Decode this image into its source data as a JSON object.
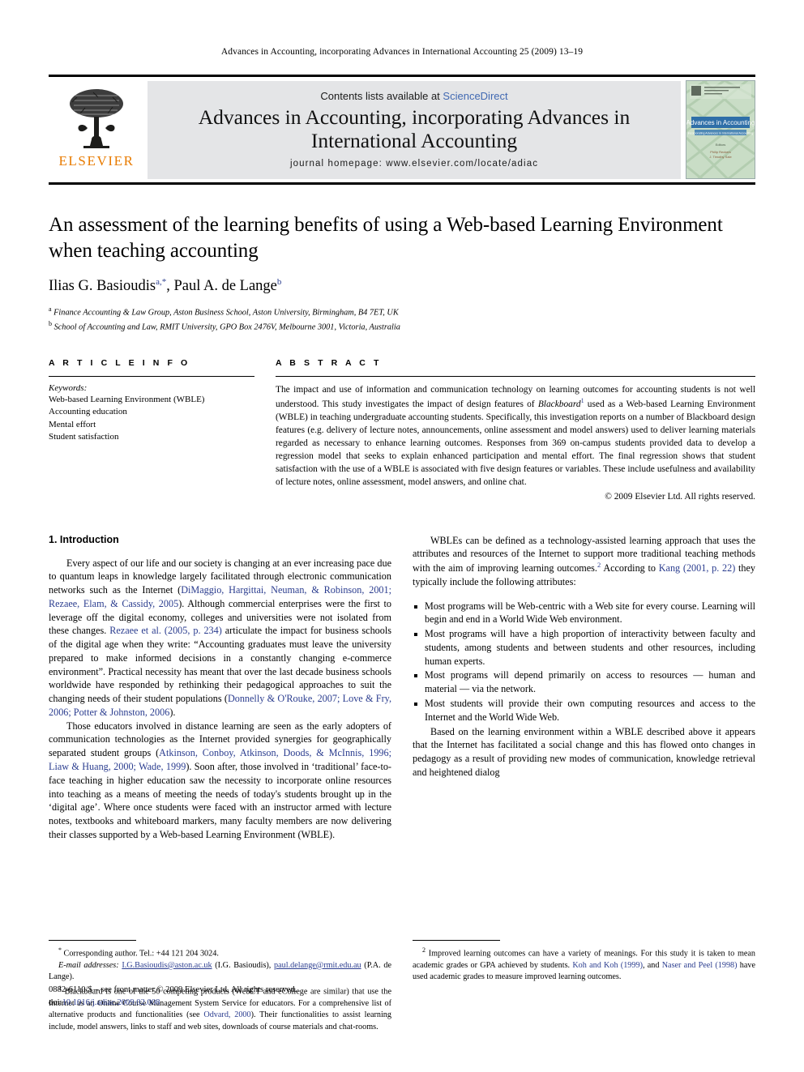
{
  "running_head": "Advances in Accounting, incorporating Advances in International Accounting 25 (2009) 13–19",
  "masthead": {
    "publisher_name": "ELSEVIER",
    "contents_prefix": "Contents lists available at",
    "contents_link": "ScienceDirect",
    "journal_title": "Advances in Accounting, incorporating Advances in International Accounting",
    "homepage": "journal homepage: www.elsevier.com/locate/adiac",
    "cover": {
      "title": "Advances in Accounting",
      "subtitle": "incorporating Advances in International Accounting",
      "editors_label": "Editors",
      "editor_1": "Philip Reckers",
      "editor_2": "J. Timothy Sale"
    }
  },
  "article": {
    "title": "An assessment of the learning benefits of using a Web-based Learning Environment when teaching accounting",
    "authors": "Ilias G. Basioudis a,*, Paul A. de Lange b",
    "author_1_name": "Ilias G. Basioudis",
    "author_1_marks": "a,*",
    "author_2_name": ", Paul A. de Lange",
    "author_2_marks": "b",
    "affiliations": [
      {
        "mark": "a",
        "text": "Finance Accounting & Law Group, Aston Business School, Aston University, Birmingham, B4 7ET, UK"
      },
      {
        "mark": "b",
        "text": "School of Accounting and Law, RMIT University, GPO Box 2476V, Melbourne 3001, Victoria, Australia"
      }
    ]
  },
  "article_info": {
    "label": "A R T I C L E     I N F O",
    "keywords_label": "Keywords:",
    "keywords": [
      "Web-based Learning Environment (WBLE)",
      "Accounting education",
      "Mental effort",
      "Student satisfaction"
    ]
  },
  "abstract": {
    "label": "A B S T R A C T",
    "part_1": "The impact and use of information and communication technology on learning outcomes for accounting students is not well understood. This study investigates the impact of design features of ",
    "italic_1": "Blackboard",
    "sup_1": "1",
    "part_2": " used as a Web-based Learning Environment (WBLE) in teaching undergraduate accounting students. Specifically, this investigation reports on a number of Blackboard design features (e.g. delivery of lecture notes, announcements, online assessment and model answers) used to deliver learning materials regarded as necessary to enhance learning outcomes. Responses from 369 on-campus students provided data to develop a regression model that seeks to explain enhanced participation and mental effort. The final regression shows that student satisfaction with the use of a WBLE is associated with five design features or variables. These include usefulness and availability of lecture notes, online assessment, model answers, and online chat.",
    "copyright": "© 2009 Elsevier Ltd. All rights reserved."
  },
  "intro": {
    "heading": "1. Introduction",
    "p1_a": "Every aspect of our life and our society is changing at an ever increasing pace due to quantum leaps in knowledge largely facilitated through electronic communication networks such as the Internet (",
    "p1_cite1": "DiMaggio, Hargittai, Neuman, & Robinson, 2001; Rezaee, Elam, & Cassidy, 2005",
    "p1_b": "). Although commercial enterprises were the first to leverage off the digital economy, colleges and universities were not isolated from these changes. ",
    "p1_cite2": "Rezaee et al. (2005, p. 234)",
    "p1_c": " articulate the impact for business schools of the digital age when they write: “Accounting graduates must leave the university prepared to make informed decisions in a constantly changing e-commerce environment”. Practical necessity has meant that over the last decade business schools worldwide have responded by rethinking their pedagogical approaches to suit the changing needs of their student populations (",
    "p1_cite3": "Donnelly & O'Rouke, 2007; Love & Fry, 2006; Potter & Johnston, 2006",
    "p1_d": ").",
    "p2_a": "Those educators involved in distance learning are seen as the early adopters of communication technologies as the Internet provided synergies for geographically separated student groups (",
    "p2_cite1": "Atkinson, Conboy, Atkinson, Doods, & McInnis, 1996; Liaw & Huang, 2000; Wade, 1999",
    "p2_b": "). Soon after, those involved in ‘traditional’ face-to-face teaching in higher education saw the necessity to incorporate online resources into teaching as a means of meeting the needs of today's students brought up in the ‘digital age’. Where once students were faced with an instructor armed with lecture notes, textbooks and whiteboard markers, many faculty members are now delivering their classes supported by a Web-based Learning Environment (WBLE).",
    "p3_a": "WBLEs can be defined as a technology-assisted learning approach that uses the attributes and resources of the Internet to support more traditional teaching methods with the aim of improving learning outcomes.",
    "p3_sup": "2",
    "p3_b": " According to ",
    "p3_cite1": "Kang (2001, p. 22)",
    "p3_c": " they typically include the following attributes:",
    "attributes": [
      "Most programs will be Web-centric with a Web site for every course. Learning will begin and end in a World Wide Web environment.",
      "Most programs will have a high proportion of interactivity between faculty and students, among students and between students and other resources, including human experts.",
      "Most programs will depend primarily on access to resources — human and material — via the network.",
      "Most students will provide their own computing resources and access to the Internet and the World Wide Web."
    ],
    "p4": "Based on the learning environment within a WBLE described above it appears that the Internet has facilitated a social change and this has flowed onto changes in pedagogy as a result of providing new modes of communication, knowledge retrieval and heightened dialog"
  },
  "footnotes": {
    "corresponding_mark": "*",
    "corresponding": "Corresponding author. Tel.: +44 121 204 3024.",
    "email_label": "E-mail addresses:",
    "email_1": "I.G.Basioudis@aston.ac.uk",
    "email_1_person": "(I.G. Basioudis),",
    "email_2": "paul.delange@rmit.edu.au",
    "email_2_person": "(P.A. de Lange).",
    "fn1_mark": "1",
    "fn1_a": "Blackboard is one of the 50 competing products (WebCT and eCollege are similar) that use the Internet as an Online Course Management System Service for educators. For a comprehensive list of alternative products and functionalities (see ",
    "fn1_cite": "Odvard, 2000",
    "fn1_b": "). Their functionalities to assist learning include, model answers, links to staff and web sites, downloads of course materials and chat-rooms.",
    "fn2_mark": "2",
    "fn2_a": "Improved learning outcomes can have a variety of meanings. For this study it is taken to mean academic grades or GPA achieved by students. ",
    "fn2_cite1": "Koh and Koh (1999)",
    "fn2_b": ", and ",
    "fn2_cite2": "Naser and Peel (1998)",
    "fn2_c": " have used academic grades to measure improved learning outcomes."
  },
  "imprint": {
    "line1": "0882-6110/$ – see front matter © 2009 Elsevier Ltd. All rights reserved.",
    "doi_label": "doi:",
    "doi": "10.1016/j.adiac.2009.02.008"
  },
  "colors": {
    "link": "#2b3d8f",
    "sciencedirect": "#4169b2",
    "elsevier_orange": "#e87b00",
    "masthead_bg": "#e4e5e7"
  }
}
